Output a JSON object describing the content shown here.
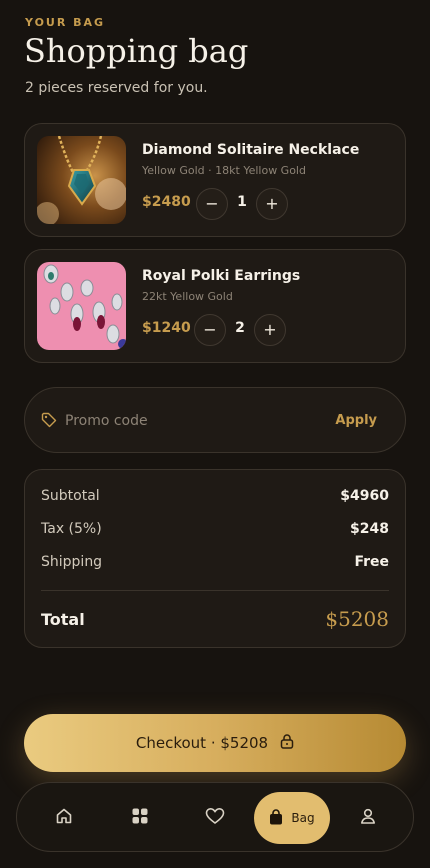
{
  "header": {
    "eyebrow": "YOUR BAG",
    "title": "Shopping bag",
    "subtitle": "2 pieces reserved for you."
  },
  "items": [
    {
      "name": "Diamond Solitaire Necklace",
      "meta": "Yellow Gold · 18kt Yellow Gold",
      "price": "$2480",
      "qty": "1",
      "minus": "−",
      "plus": "+"
    },
    {
      "name": "Royal Polki Earrings",
      "meta": "22kt Yellow Gold",
      "price": "$1240",
      "qty": "2",
      "minus": "−",
      "plus": "+"
    }
  ],
  "promo": {
    "placeholder": "Promo code",
    "apply_label": "Apply"
  },
  "summary": {
    "subtotal_label": "Subtotal",
    "subtotal_value": "$4960",
    "tax_label": "Tax (5%)",
    "tax_value": "$248",
    "shipping_label": "Shipping",
    "shipping_value": "Free",
    "total_label": "Total",
    "total_value": "$5208"
  },
  "checkout": {
    "label": "Checkout · $5208"
  },
  "nav": {
    "items": [
      "home-icon",
      "grid-icon",
      "heart-icon",
      "bag-icon",
      "user-icon"
    ],
    "active_label": "Bag"
  },
  "colors": {
    "background": "#17130f",
    "accent_gold": "#c69c4e",
    "card": "#1f1a15",
    "nav_active": "#e2bd6f"
  }
}
